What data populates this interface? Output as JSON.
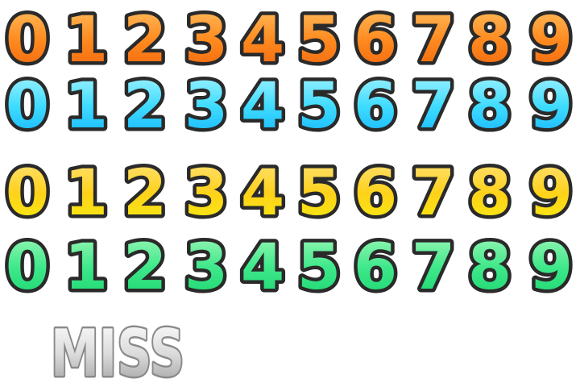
{
  "sprite_sheet": {
    "digit_rows": [
      {
        "name": "orange",
        "digits": [
          "0",
          "1",
          "2",
          "3",
          "4",
          "5",
          "6",
          "7",
          "8",
          "9"
        ],
        "gradient": [
          "#ffc061",
          "#ff8a1f",
          "#f0620a"
        ]
      },
      {
        "name": "cyan",
        "digits": [
          "0",
          "1",
          "2",
          "3",
          "4",
          "5",
          "6",
          "7",
          "8",
          "9"
        ],
        "gradient": [
          "#a8f4ff",
          "#3fdcff",
          "#0fb0ff"
        ]
      },
      {
        "name": "yellow",
        "digits": [
          "0",
          "1",
          "2",
          "3",
          "4",
          "5",
          "6",
          "7",
          "8",
          "9"
        ],
        "gradient": [
          "#ffe17a",
          "#ffd21a",
          "#f3ee10"
        ]
      },
      {
        "name": "green",
        "digits": [
          "0",
          "1",
          "2",
          "3",
          "4",
          "5",
          "6",
          "7",
          "8",
          "9"
        ],
        "gradient": [
          "#9ff7b9",
          "#3ee88a",
          "#18d46e"
        ]
      }
    ],
    "miss_label": {
      "text": "MISS",
      "gradient": [
        "#ffffff",
        "#dcdcdc",
        "#9a9a9a"
      ]
    },
    "outline_color": "#2a2a2a",
    "halo_color": "#ffffff"
  }
}
